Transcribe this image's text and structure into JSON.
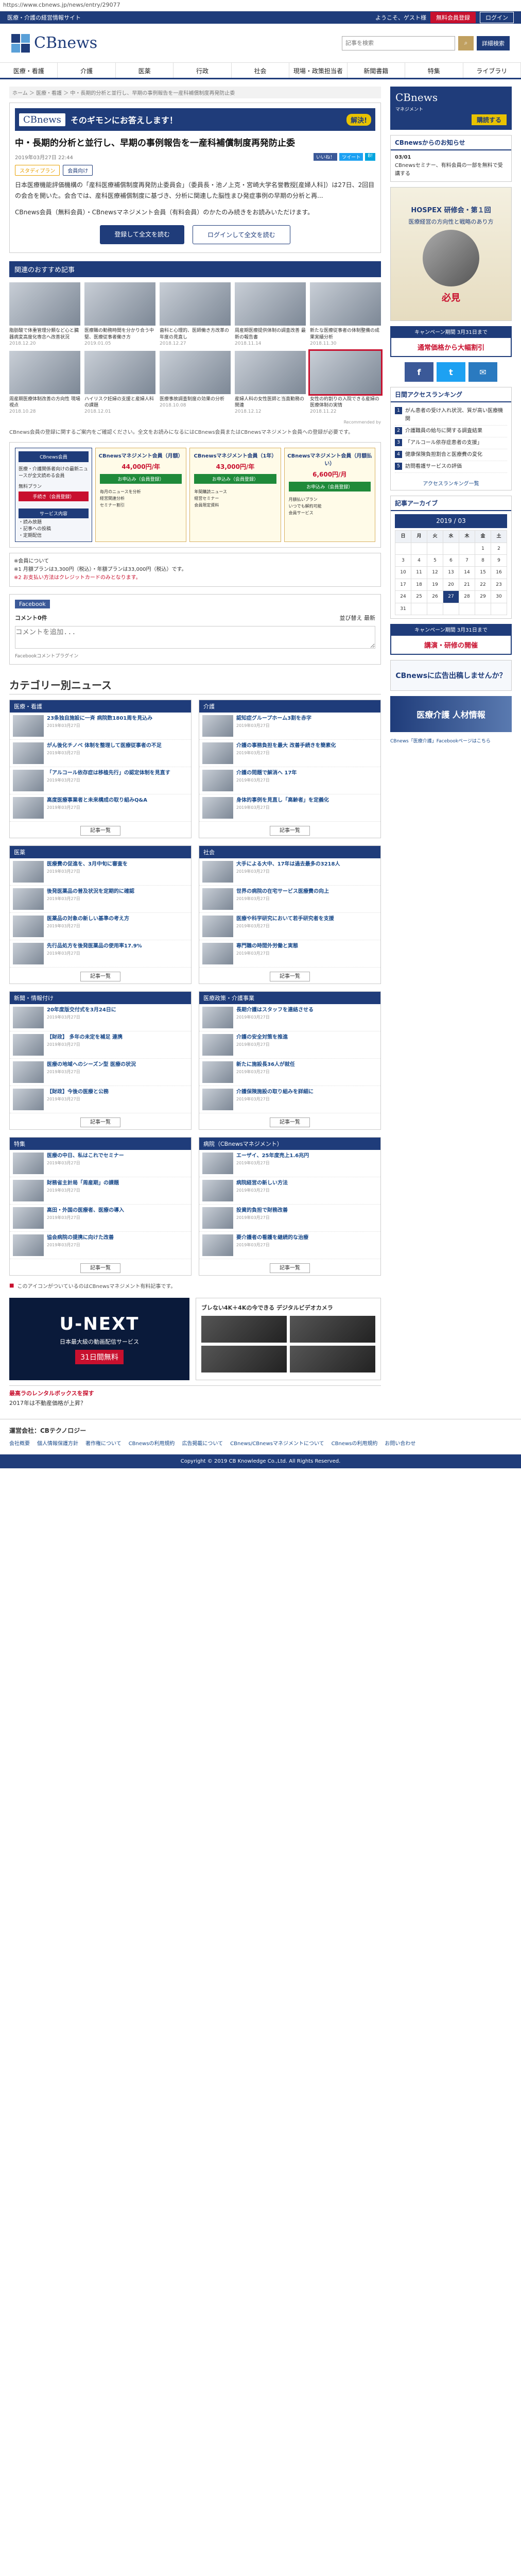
{
  "url": "https://www.cbnews.jp/news/entry/29077",
  "topbar": {
    "left": "医療・介護の経営情報サイト",
    "welcome": "ようこそ、ゲスト様",
    "register": "無料会員登録",
    "login": "ログイン"
  },
  "header": {
    "logo": "CBnews",
    "search_placeholder": "記事を検索",
    "detail_search": "詳細検索"
  },
  "gnav": [
    "医療・看護",
    "介護",
    "医薬",
    "行政",
    "社会",
    "現場・政策担当者",
    "新聞書籍",
    "特集",
    "ライブラリ"
  ],
  "breadcrumb": "ホーム ＞ 医療・看護 ＞ 中・長期的分析と並行し、早期の事例報告を一産科補償制度再発防止委",
  "article": {
    "banner_title": "そのギモンにお答えします！",
    "banner_badge": "解決!",
    "title": "中・長期的分析と並行し、早期の事例報告を一産科補償制度再発防止委",
    "date": "2019年03月27日 22:44",
    "share": [
      "いいね！",
      "ツイート",
      "B!"
    ],
    "tags": [
      "スタディプラン",
      "会員向け"
    ],
    "paragraphs": [
      "日本医療機能評価機構の「産科医療補償制度再発防止委員会」（委員長・池ノ上克・宮崎大学名誉教授[産婦人科]）は27日、2回目の会合を開いた。会合では、産科医療補償制度に基づき、分析に関連した脳性まひ発症事例の早期の分析と再...",
      "CBnews会員（無料会員）・CBnewsマネジメント会員（有料会員）のかたのみ続きをお読みいただけます。"
    ],
    "cta_primary": "登録して全文を読む",
    "cta_secondary": "ログインして全文を読む"
  },
  "recommend": {
    "heading": "関連のおすすめ記事",
    "items": [
      {
        "title": "脂肪酸で体重管理分類など心と臓器病変高度化専念へ改善状況",
        "date": "2018.12.20"
      },
      {
        "title": "医療職の勤務時間を分かり合う中堅、医療従事者働き方",
        "date": "2019.01.05"
      },
      {
        "title": "歯科と心理的、医師働き方改革の年度の見直し",
        "date": "2018.12.27"
      },
      {
        "title": "周産期医療提供体制の調査改善 最新の報告書",
        "date": "2018.11.14"
      },
      {
        "title": "新たな医療従事者の体制整備の成果実績分析",
        "date": "2018.11.30"
      },
      {
        "title": "周産期医療体制改善の方向性 現場視点",
        "date": "2018.10.28"
      },
      {
        "title": "ハイリスク妊婦の支援と産婦人科の課題",
        "date": "2018.12.01"
      },
      {
        "title": "医療事故調査制度の効果の分析",
        "date": "2018.10.08"
      },
      {
        "title": "産婦人科の女性医師と当直勤務の関連",
        "date": "2018.12.12"
      },
      {
        "title": "女性の約割りの入院できる産婦の医療体制の実情",
        "date": "2018.11.22"
      }
    ],
    "pr": "Recommended by"
  },
  "notice": "CBnews会員の登録に関するご案内をご確認ください。全文をお読みになるにはCBnews会員またはCBnewsマネジメント会員への登録が必要です。",
  "plans": {
    "left_head": "CBnews会員",
    "left_desc": "医療・介護関係者向けの最新ニュースが全文読める会員",
    "left_items": [
      "無料プラン",
      "手続き（会員登録）",
      "サービス内容",
      "・読み放題",
      "・記事への投稿",
      "・定期配信"
    ],
    "plans": [
      {
        "name": "CBnewsマネジメント会員（月額）",
        "price": "44,000円/年",
        "btn": "お申込み（会員登録）",
        "items": [
          "毎月のニュースを分析",
          "経営関連分析",
          "セミナー割引"
        ]
      },
      {
        "name": "CBnewsマネジメント会員（1年）",
        "price": "43,000円/年",
        "btn": "お申込み（会員登録）",
        "items": [
          "年間購読ニュース",
          "経営セミナー",
          "会員限定資料"
        ]
      },
      {
        "name": "CBnewsマネジメント会員（月額払い）",
        "price": "6,600円/月",
        "btn": "お申込み（会員登録）",
        "items": [
          "月額払いプラン",
          "いつでも解約可能",
          "会員サービス"
        ]
      }
    ]
  },
  "fee": {
    "title": "※会員について",
    "line1": "※1 月額プランは3,300円（税込）・年額プランは33,000円（税込）です。",
    "line2": "※2 お支払い方法はクレジットカードのみとなります。"
  },
  "facebook": {
    "label": "Facebook",
    "comments": "コメント0件",
    "sort": "並び替え 最新",
    "placeholder": "コメントを追加...",
    "plugin": "Facebookコメントプラグイン"
  },
  "categories": {
    "title": "カテゴリー別ニュース",
    "more": "記事一覧",
    "blocks": [
      {
        "name": "医療・看護",
        "items": [
          {
            "t": "23条独自施設に一斉 病院数1801周を見込み",
            "d": "2019年03月27日"
          },
          {
            "t": "がん後化チノベ 体制を整理して医療従事者の不足",
            "d": "2019年03月27日"
          },
          {
            "t": "「アルコール依存症は移植先行」の認定体制を見直す",
            "d": "2019年03月27日"
          },
          {
            "t": "高度医療事業者と未来構成の取り組みQ&A",
            "d": "2019年03月27日"
          }
        ]
      },
      {
        "name": "介護",
        "items": [
          {
            "t": "認知症グループホーム3割を赤字",
            "d": "2019年03月27日"
          },
          {
            "t": "介護の事務負担を最大 改善手続きを簡素化",
            "d": "2019年03月27日"
          },
          {
            "t": "介護の問題で解消へ 17年",
            "d": "2019年03月27日"
          },
          {
            "t": "身体的事例を見直し「高齢者」を定義化",
            "d": "2019年03月27日"
          }
        ]
      },
      {
        "name": "医薬",
        "items": [
          {
            "t": "医療費の促進を、3月中旬に審査を",
            "d": "2019年03月27日"
          },
          {
            "t": "後発医薬品の普及状況を定期的に確認",
            "d": "2019年03月27日"
          },
          {
            "t": "医薬品の対象の新しい基準の考え方",
            "d": "2019年03月27日"
          },
          {
            "t": "先行品処方を後発医薬品の使用率17.9%",
            "d": "2019年03月27日"
          }
        ]
      },
      {
        "name": "社会",
        "items": [
          {
            "t": "大手による大中、17年は過去最多の3218人",
            "d": "2019年03月27日"
          },
          {
            "t": "世界の病院の在宅サービス医療費の向上",
            "d": "2019年03月27日"
          },
          {
            "t": "医療や科学研究において若手研究者を支援",
            "d": "2019年03月27日"
          },
          {
            "t": "専門職の時間外労働と実態",
            "d": "2019年03月27日"
          }
        ]
      },
      {
        "name": "新聞・情報付け",
        "items": [
          {
            "t": "20年度版交付式を3月24日に",
            "d": "2019年03月27日"
          },
          {
            "t": "【財政】 多年の未定を補足 連携",
            "d": "2019年03月27日"
          },
          {
            "t": "医療の地域へのシーズン型 医療の状況",
            "d": "2019年03月27日"
          },
          {
            "t": "【財政】今後の医療と公務",
            "d": "2019年03月27日"
          }
        ]
      },
      {
        "name": "医療政策・介護事業",
        "items": [
          {
            "t": "長期介護はスタッフを連絡させる",
            "d": "2019年03月27日"
          },
          {
            "t": "介護の安全対策を推進",
            "d": "2019年03月27日"
          },
          {
            "t": "新たに施設長36人が就任",
            "d": "2019年03月27日"
          },
          {
            "t": "介護保険施設の取り組みを詳細に",
            "d": "2019年03月27日"
          }
        ]
      },
      {
        "name": "特集",
        "items": [
          {
            "t": "医療の中日、私はこれでセミナー",
            "d": "2019年03月27日"
          },
          {
            "t": "財務省主計局「周産期」の課題",
            "d": "2019年03月27日"
          },
          {
            "t": "高田・外国の医療者、医療の導入",
            "d": "2019年03月27日"
          },
          {
            "t": "協会病院の提携に向けた改善",
            "d": "2019年03月27日"
          }
        ]
      },
      {
        "name": "病院（CBnewsマネジメント）",
        "items": [
          {
            "t": "エーザイ、25年度売上1.6兆円",
            "d": "2019年03月27日"
          },
          {
            "t": "病院経営の新しい方法",
            "d": "2019年03月27日"
          },
          {
            "t": "投資的負担で財務改善",
            "d": "2019年03月27日"
          },
          {
            "t": "要介護者の看護を継続的な治療",
            "d": "2019年03月27日"
          }
        ]
      }
    ]
  },
  "pr_note": "このアイコンがついているのはCBnewsマネジメント有料記事です。",
  "ads": {
    "unext": "U-NEXT",
    "unext_sub": "日本最大級の動画配信サービス",
    "unext_day": "31日間無料",
    "mag_title": "ブレない4K＋4Kの今できる デジタルビデオカメラ",
    "textad_head": "最高ラのレンタルボックスを探す",
    "textad_line": "2017年は不動産価格が上昇？"
  },
  "side": {
    "mgmt_title": "CBnews",
    "mgmt_sub": "マネジメント",
    "mgmt_btn": "購読する",
    "notice_head": "CBnewsからのお知らせ",
    "notice_date": "03/01",
    "notice_text": "CBnewsセミナー、有料会員の一部を無料で受講する",
    "photo_title": "HOSPEX 研修会・第１回",
    "photo_sub": "医療経営の方向性と戦略のあり方",
    "photo_badge": "必見",
    "camp1": "キャンペーン期間 3月31日まで",
    "camp1_body": "通常価格から大幅割引",
    "social": [
      "f",
      "t",
      "✉"
    ],
    "rank_head": "日間アクセスランキング",
    "rank_items": [
      "がん患者の受け入れ状況、質が高い医療機関",
      "介護職員の給与に関する調査結果",
      "「アルコール依存症患者の支援」",
      "健康保険負担割合と医療費の変化",
      "訪問看護サービスの評価"
    ],
    "rank_more": "アクセスランキング一覧",
    "cal_head": "記事アーカイブ",
    "cal_ym": "2019 / 03",
    "cal_week": [
      "日",
      "月",
      "火",
      "水",
      "木",
      "金",
      "土"
    ],
    "cal_rows": [
      [
        "",
        "",
        "",
        "",
        "",
        "1",
        "2"
      ],
      [
        "3",
        "4",
        "5",
        "6",
        "7",
        "8",
        "9"
      ],
      [
        "10",
        "11",
        "12",
        "13",
        "14",
        "15",
        "16"
      ],
      [
        "17",
        "18",
        "19",
        "20",
        "21",
        "22",
        "23"
      ],
      [
        "24",
        "25",
        "26",
        "27",
        "28",
        "29",
        "30"
      ],
      [
        "31",
        "",
        "",
        "",
        "",
        "",
        ""
      ]
    ],
    "camp2": "キャンペーン期間 3月31日まで",
    "camp2_body": "講演・研修の開催",
    "small_banner": "CBnewsに広告出稿しませんか？",
    "kaigo_ad": "医療介護 人材情報",
    "bottom_link": "CBnews「医療介護」Facebookページはこちら"
  },
  "foot": {
    "company": "運営会社：CBテクノロジー",
    "links": [
      "会社概要",
      "個人情報保護方針",
      "著作権について",
      "CBnewsの利用規約",
      "広告掲載について",
      "CBnews/CBnewsマネジメントについて",
      "CBnewsの利用規約",
      "お問い合わせ"
    ],
    "copyright": "Copyright © 2019 CB Knowledge Co.,Ltd. All Rights Reserved."
  }
}
